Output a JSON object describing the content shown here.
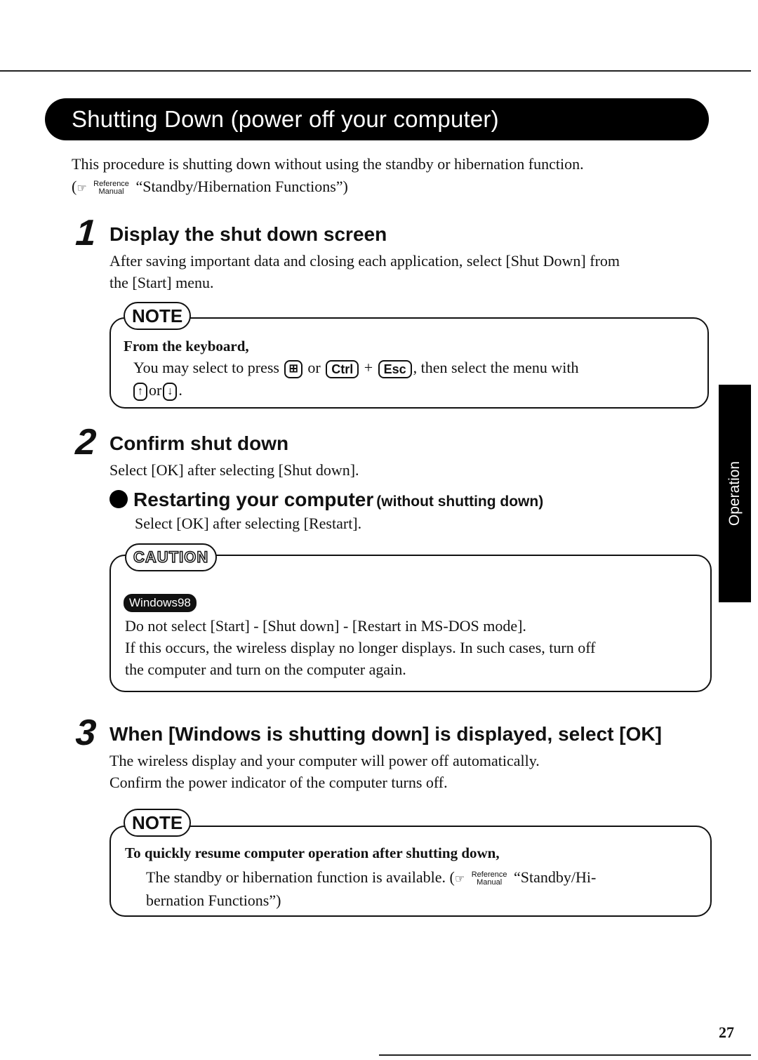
{
  "title": "Shutting Down (power off your computer)",
  "intro": {
    "line1": "This procedure is shutting down without using the standby or hibernation function.",
    "ref_open": "(",
    "ref_tag_top": "Reference",
    "ref_tag_bottom": "Manual",
    "ref_text": "“Standby/Hibernation Functions”)"
  },
  "steps": [
    {
      "number": "1",
      "title": "Display the shut down screen",
      "body": [
        "After saving important data and closing each application, select [Shut Down] from",
        "the [Start] menu."
      ]
    },
    {
      "number": "2",
      "title": "Confirm shut down",
      "body": [
        "Select [OK] after selecting [Shut down]."
      ],
      "sub": {
        "title": "Restarting your computer",
        "title_suffix": "(without shutting down)",
        "body": "Select [OK] after selecting [Restart]."
      }
    },
    {
      "number": "3",
      "title": "When [Windows is shutting down] is displayed, select [OK]",
      "body": [
        "The wireless display and your computer will power off automatically.",
        "Confirm the power indicator of the computer turns off."
      ]
    }
  ],
  "note1": {
    "label": "NOTE",
    "heading": "From the keyboard,",
    "text_a": "You may select to press",
    "win_key": "⊞",
    "or1": "or",
    "ctrl_key": "Ctrl",
    "plus": "+",
    "esc_key": "Esc",
    "text_b": ", then select the menu with",
    "up_key": "↑",
    "or2": "or",
    "down_key": "↓",
    "end": "."
  },
  "caution": {
    "label": "CAUTION",
    "os_badge": "Windows98",
    "line1": "Do not select [Start] - [Shut down] - [Restart in MS-DOS mode].",
    "line2": "If this occurs, the wireless display no longer displays.  In such cases, turn off",
    "line3": "the computer and turn on the computer again."
  },
  "note2": {
    "label": "NOTE",
    "heading": "To quickly resume computer operation after shutting down,",
    "line1": "The standby or hibernation function is available. (",
    "ref_tag_top": "Reference",
    "ref_tag_bottom": "Manual",
    "line1_end": "“Standby/Hi-",
    "line2": "bernation Functions”)"
  },
  "side_tab": "Operation",
  "page_number": "27"
}
